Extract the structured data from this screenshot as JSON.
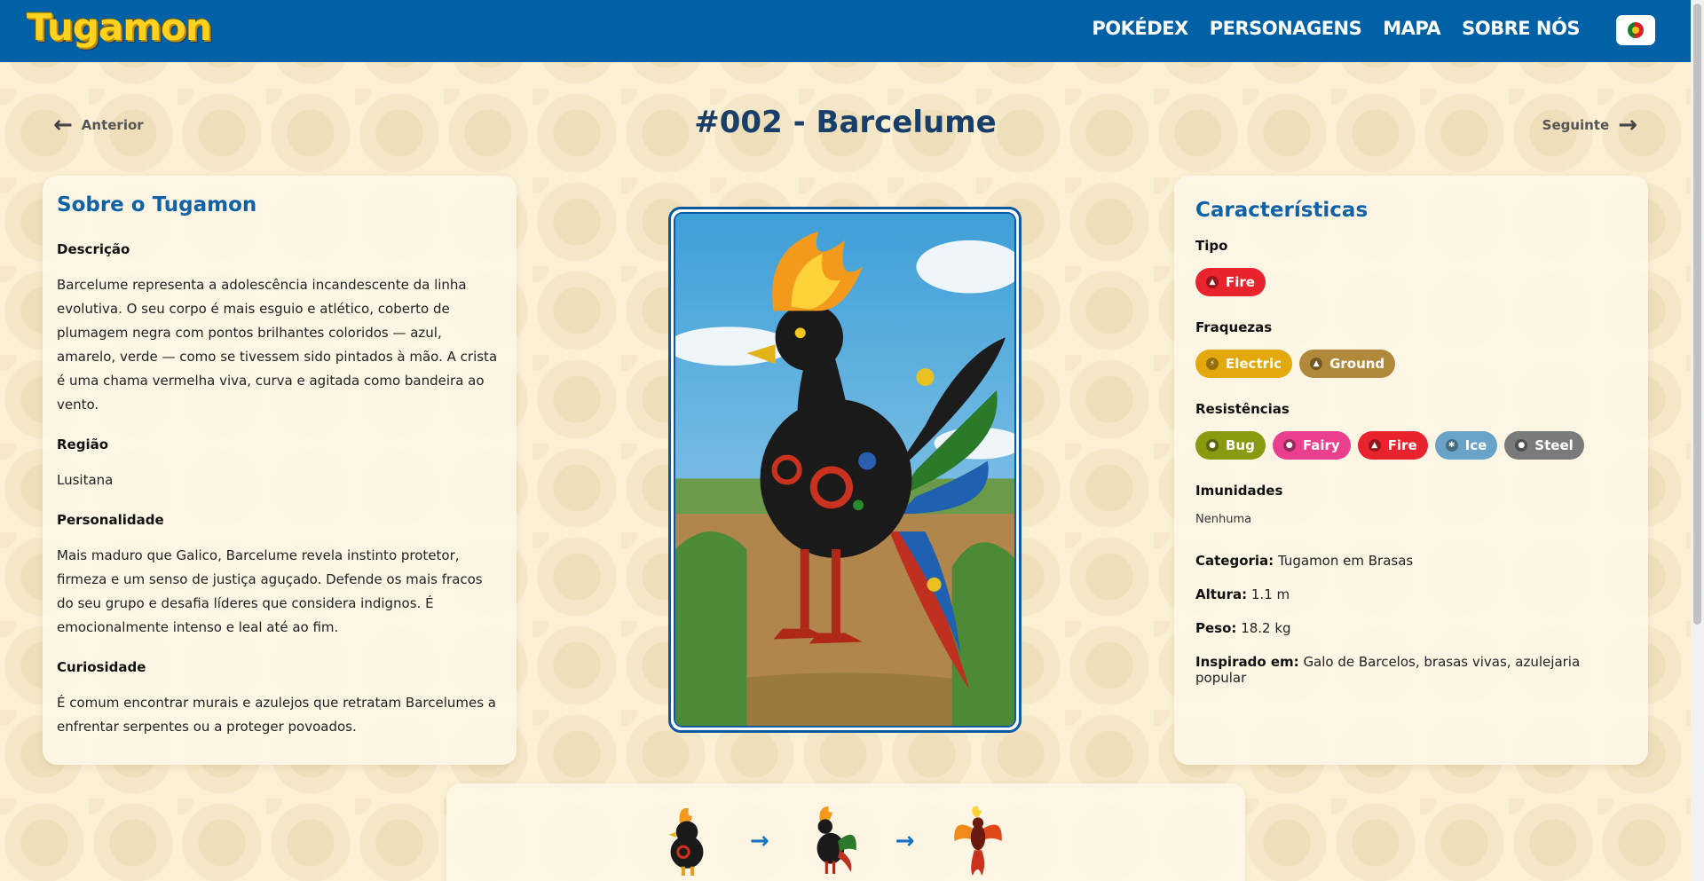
{
  "header": {
    "logo": "Tugamon",
    "nav": [
      "POKÉDEX",
      "PERSONAGENS",
      "MAPA",
      "SOBRE NÓS"
    ],
    "language_icon": "portugal-flag-icon"
  },
  "pager": {
    "prev_label": "Anterior",
    "next_label": "Seguinte",
    "title": "#002 - Barcelume"
  },
  "about": {
    "heading": "Sobre o Tugamon",
    "description_label": "Descrição",
    "description": "Barcelume representa a adolescência incandescente da linha evolutiva. O seu corpo é mais esguio e atlético, coberto de plumagem negra com pontos brilhantes coloridos — azul, amarelo, verde — como se tivessem sido pintados à mão. A crista é uma chama vermelha viva, curva e agitada como bandeira ao vento.",
    "region_label": "Região",
    "region": "Lusitana",
    "personality_label": "Personalidade",
    "personality": "Mais maduro que Galico, Barcelume revela instinto protetor, firmeza e um senso de justiça aguçado. Defende os mais fracos do seu grupo e desafia líderes que considera indignos. É emocionalmente intenso e leal até ao fim.",
    "trivia_label": "Curiosidade",
    "trivia": "É comum encontrar murais e azulejos que retratam Barcelumes a enfrentar serpentes ou a proteger povoados."
  },
  "stats": {
    "heading": "Características",
    "type_label": "Tipo",
    "types": [
      {
        "label": "Fire",
        "color": "#e8232e",
        "icon": "fire-icon"
      }
    ],
    "weak_label": "Fraquezas",
    "weaknesses": [
      {
        "label": "Electric",
        "color": "#e3a90c",
        "icon": "electric-icon"
      },
      {
        "label": "Ground",
        "color": "#b0893a",
        "icon": "ground-icon"
      }
    ],
    "resist_label": "Resistências",
    "resistances": [
      {
        "label": "Bug",
        "color": "#8a9a10",
        "icon": "bug-icon"
      },
      {
        "label": "Fairy",
        "color": "#ea3f8e",
        "icon": "fairy-icon"
      },
      {
        "label": "Fire",
        "color": "#e8232e",
        "icon": "fire-icon"
      },
      {
        "label": "Ice",
        "color": "#6aa3c8",
        "icon": "ice-icon"
      },
      {
        "label": "Steel",
        "color": "#7a7a7a",
        "icon": "steel-icon"
      }
    ],
    "immune_label": "Imunidades",
    "immunities": "Nenhuma",
    "category_label": "Categoria:",
    "category": "Tugamon em Brasas",
    "height_label": "Altura:",
    "height": "1.1 m",
    "weight_label": "Peso:",
    "weight": "18.2 kg",
    "inspired_label": "Inspirado em:",
    "inspired": "Galo de Barcelos, brasas vivas, azulejaria popular"
  },
  "evolution": {
    "stages": [
      "galico-sprite",
      "barcelume-sprite",
      "fenix-sprite"
    ],
    "arrow_icon": "arrow-right-icon"
  }
}
